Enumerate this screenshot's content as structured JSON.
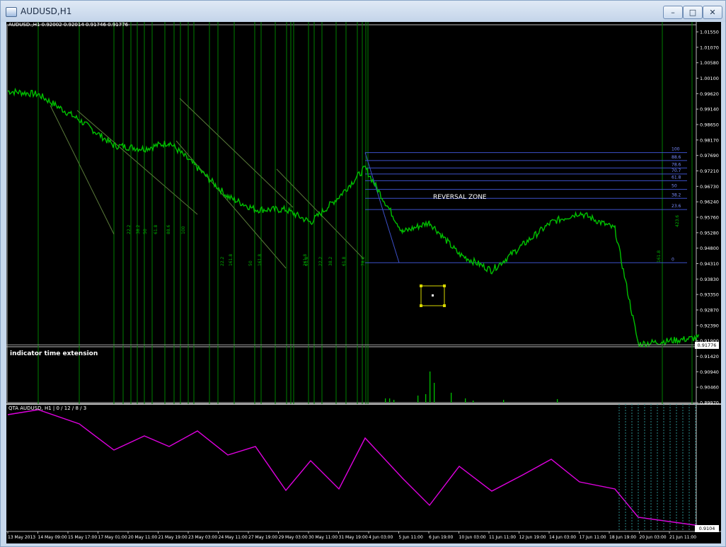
{
  "window": {
    "title": "AUDUSD,H1",
    "buttons": [
      "minimize",
      "maximize",
      "close"
    ]
  },
  "chart": {
    "info_line": "AUDUSD.,H1  0.92002 0.92014 0.91746 0.91776",
    "current_price": "0.91776",
    "price_labels": [
      "1.01550",
      "1.01070",
      "1.00580",
      "1.00100",
      "0.99620",
      "0.99140",
      "0.98650",
      "0.98170",
      "0.97690",
      "0.97210",
      "0.96730",
      "0.96240",
      "0.95760",
      "0.95280",
      "0.94800",
      "0.94310",
      "0.93830",
      "0.93350",
      "0.92870",
      "0.92390",
      "0.91900",
      "0.91420",
      "0.90940",
      "0.90460",
      "0.89970"
    ],
    "time_labels": [
      "13 May 2013",
      "14 May 09:00",
      "15 May 17:00",
      "17 May 01:00",
      "20 May 11:00",
      "21 May 19:00",
      "23 May 03:00",
      "24 May 11:00",
      "27 May 19:00",
      "29 May 03:00",
      "30 May 11:00",
      "31 May 19:00",
      "4 Jun 03:00",
      "5 Jun 11:00",
      "6 Jun 19:00",
      "10 Jun 03:00",
      "11 Jun 11:00",
      "12 Jun 19:00",
      "14 Jun 03:00",
      "17 Jun 11:00",
      "18 Jun 19:00",
      "20 Jun 03:00",
      "21 Jun 11:00"
    ],
    "fib_levels": [
      "100",
      "88.6",
      "78.6",
      "70.7",
      "61.8",
      "50",
      "38.2",
      "23.6",
      "0"
    ],
    "fib_vertical_labels_left": [
      "22.2",
      "38.2",
      "50",
      "61.8",
      "88.6",
      "100",
      "22.2",
      "161.8",
      "50",
      "161.8",
      "261.8",
      "61.8",
      "22.2",
      "38.2",
      "61.8",
      "78.6"
    ],
    "fib_vertical_labels_right": [
      "161.8",
      "423.6"
    ],
    "reversal_label": "REVERSAL ZONE",
    "extension_label": "indicator time extension",
    "subwindow_label": "QTA AUDUSD, H1 | 0 / 12 / 8 / 3",
    "subwindow_value": "0.9104",
    "colors": {
      "candle": "#00c000",
      "grid_line": "#008000",
      "fib": "#3c50c8",
      "qta": "#e000e0",
      "box": "#d8d800"
    }
  },
  "chart_data": {
    "type": "line",
    "title": "AUDUSD,H1",
    "xlabel": "",
    "ylabel": "",
    "ylim": [
      0.8997,
      1.0155
    ],
    "x": [
      "13 May 2013",
      "14 May 09:00",
      "15 May 17:00",
      "17 May 01:00",
      "20 May 11:00",
      "21 May 19:00",
      "23 May 03:00",
      "24 May 11:00",
      "27 May 19:00",
      "29 May 03:00",
      "30 May 11:00",
      "31 May 19:00",
      "4 Jun 03:00",
      "5 Jun 11:00",
      "6 Jun 19:00",
      "10 Jun 03:00",
      "11 Jun 11:00",
      "12 Jun 19:00",
      "14 Jun 03:00",
      "17 Jun 11:00",
      "18 Jun 19:00",
      "20 Jun 03:00",
      "21 Jun 11:00"
    ],
    "series": [
      {
        "name": "",
        "values": [
          0.997,
          0.996,
          0.988,
          0.98,
          0.979,
          0.981,
          0.973,
          0.964,
          0.96,
          0.96,
          0.956,
          0.964,
          0.973,
          0.953,
          0.956,
          0.946,
          0.941,
          0.949,
          0.956,
          0.959,
          0.954,
          0.918,
          0.92
        ]
      }
    ]
  }
}
